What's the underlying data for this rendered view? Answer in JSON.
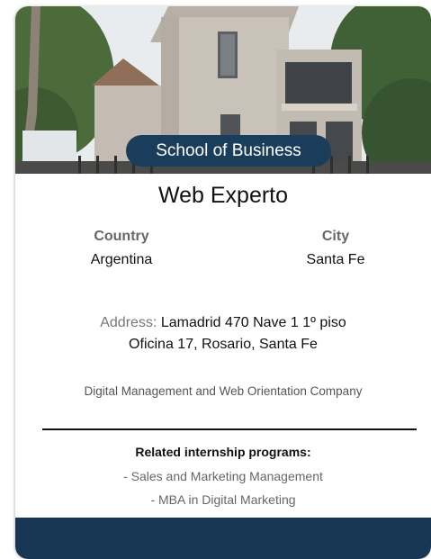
{
  "card": {
    "badge_label": "School of Business",
    "title": "Web Experto",
    "country_label": "Country",
    "country_value": "Argentina",
    "city_label": "City",
    "city_value": "Santa Fe",
    "address_label": "Address:",
    "address_line1": "Lamadrid 470 Nave 1 1º piso",
    "address_line2": "Oficina 17, Rosario, Santa Fe",
    "description": "Digital Management and Web Orientation Company",
    "related_title": "Related internship programs:",
    "related_programs": [
      "- Sales and Marketing Management",
      "- MBA in Digital Marketing"
    ]
  },
  "colors": {
    "badge_bg": "#1b3d5c",
    "footer_bg": "#163653"
  }
}
